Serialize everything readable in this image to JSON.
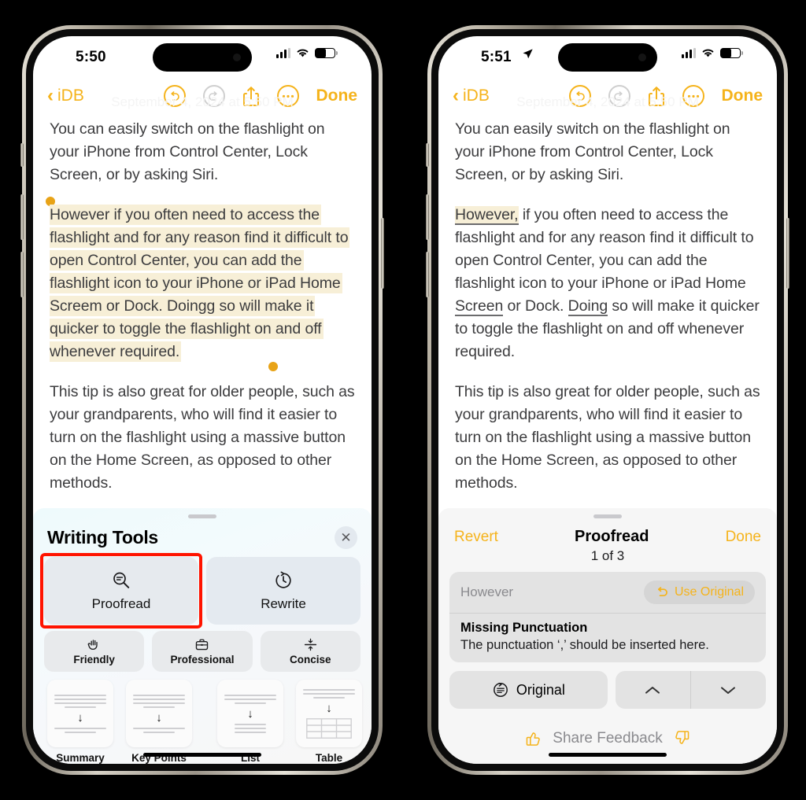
{
  "left_phone": {
    "status": {
      "time": "5:50",
      "location_icon": false,
      "signal": "signal-icon",
      "wifi": "wifi-icon",
      "battery": "battery-icon"
    },
    "nav": {
      "back_label": "iDB",
      "undo": "undo-icon",
      "redo": "redo-icon",
      "share": "share-icon",
      "more": "more-icon",
      "done_label": "Done"
    },
    "ghost_date": "September 4, 2024 at 5:50 PM",
    "note": {
      "para1": "You can easily switch on the flashlight on your iPhone from Control Center, Lock Screen, or by asking Siri.",
      "para2_selected": "However if you often need to access the flashlight and for any reason find it difficult to open Control Center, you can add the flashlight icon to your iPhone or iPad Home Screem or Dock. Doingg so will make it quicker to toggle the flashlight on and off whenever required.",
      "para3": "This tip is also great for older people, such as your grandparents, who will find it easier to turn on the flashlight using a massive button on the Home Screen, as opposed to other methods."
    },
    "writing_tools": {
      "title": "Writing Tools",
      "close": "close-icon",
      "primary": [
        {
          "label": "Proofread",
          "icon": "magnifier-minus-icon",
          "highlighted": true
        },
        {
          "label": "Rewrite",
          "icon": "rewrite-clock-icon",
          "highlighted": false
        }
      ],
      "tones": [
        {
          "label": "Friendly",
          "icon": "waving-hand-icon"
        },
        {
          "label": "Professional",
          "icon": "briefcase-icon"
        },
        {
          "label": "Concise",
          "icon": "compress-icon"
        }
      ],
      "transforms": [
        {
          "label": "Summary",
          "icon": "summary-icon"
        },
        {
          "label": "Key Points",
          "icon": "key-points-icon"
        },
        {
          "label": "List",
          "icon": "list-icon"
        },
        {
          "label": "Table",
          "icon": "table-icon"
        }
      ]
    }
  },
  "right_phone": {
    "status": {
      "time": "5:51",
      "location_icon": true,
      "signal": "signal-icon",
      "wifi": "wifi-icon",
      "battery": "battery-icon"
    },
    "nav": {
      "back_label": "iDB",
      "undo": "undo-icon",
      "redo": "redo-icon",
      "share": "share-icon",
      "more": "more-icon",
      "done_label": "Done"
    },
    "ghost_date": "September 4, 2024 at 5:50 PM",
    "note": {
      "para1": "You can easily switch on the flashlight on your iPhone from Control Center, Lock Screen, or by asking Siri.",
      "para2": {
        "c1": "However,",
        "t1": " if you often need to access the flashlight and for any reason find it difficult to open Control Center, you can add the flashlight icon to your iPhone or iPad Home ",
        "c2": "Screen",
        "t2": " or Dock. ",
        "c3": "Doing",
        "t3": " so will make it quicker to toggle the flashlight on and off whenever required."
      },
      "para3": "This tip is also great for older people, such as your grandparents, who will find it easier to turn on the flashlight using a massive button on the Home Screen, as opposed to other methods."
    },
    "proofread": {
      "revert_label": "Revert",
      "title": "Proofread",
      "done_label": "Done",
      "counter": "1 of 3",
      "suggestion_word": "However",
      "use_original_label": "Use Original",
      "use_original_icon": "undo-arrow-icon",
      "issue_title": "Missing Punctuation",
      "issue_detail": "The punctuation ‘,’ should be inserted here.",
      "original_label": "Original",
      "original_icon": "original-lines-icon",
      "prev_icon": "chevron-up-icon",
      "next_icon": "chevron-down-icon",
      "feedback_label": "Share Feedback",
      "thumbs_up_icon": "thumbs-up-icon",
      "thumbs_down_icon": "thumbs-down-icon"
    }
  },
  "colors": {
    "accent_yellow": "#F5B31B",
    "highlight": "#F7EFD7",
    "red_box": "#FF1400",
    "background": "#000000"
  }
}
